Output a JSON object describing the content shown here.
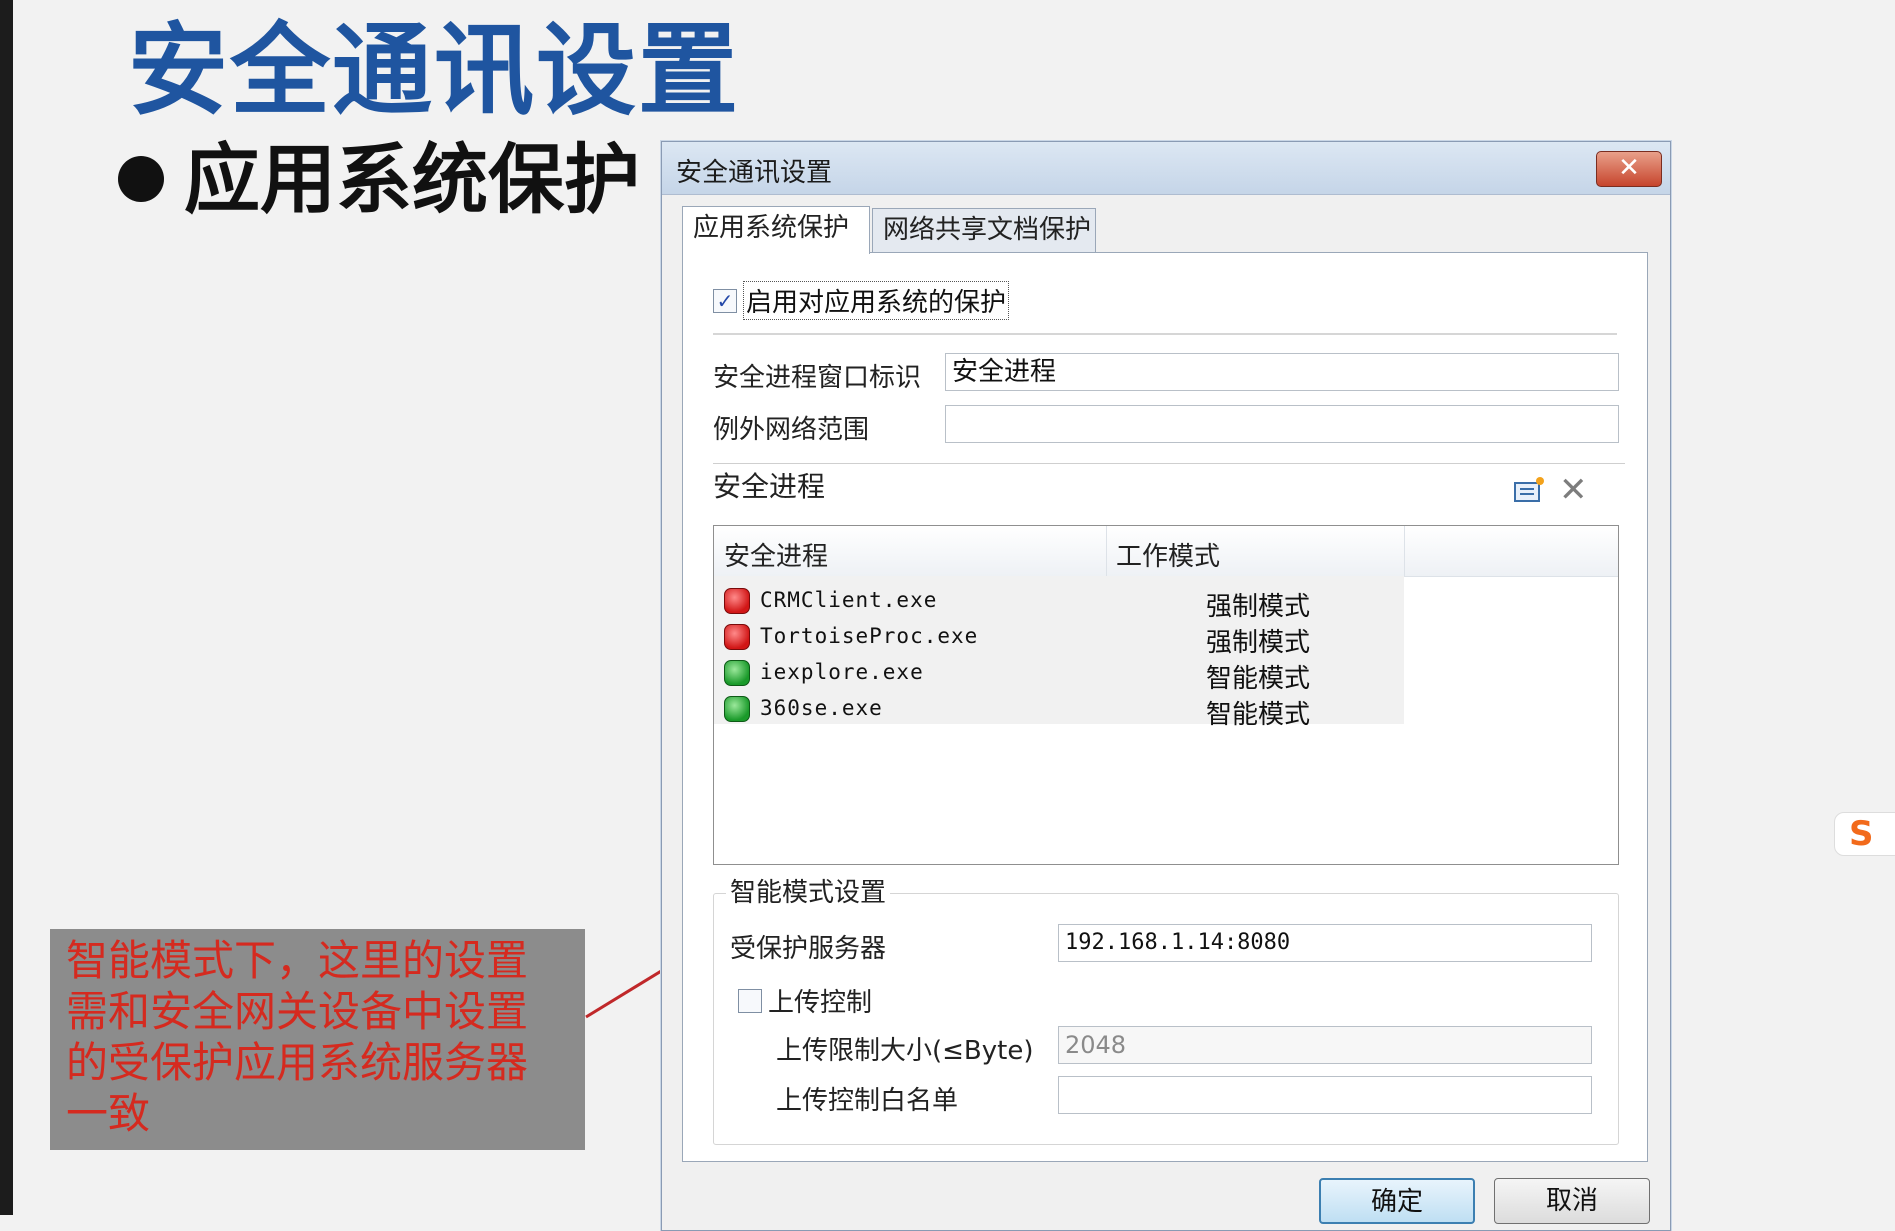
{
  "slide": {
    "title": "安全通讯设置",
    "bullet": "应用系统保护",
    "callout": "智能模式下，这里的设置需和安全网关设备中设置的受保护应用系统服务器一致"
  },
  "dialog": {
    "title": "安全通讯设置",
    "close_label": "✕",
    "tabs": [
      {
        "label": "应用系统保护",
        "active": true
      },
      {
        "label": "网络共享文档保护",
        "active": false
      }
    ],
    "enable_checkbox": {
      "label": "启用对应用系统的保护",
      "checked": true,
      "mark": "✓"
    },
    "fields": {
      "window_id_label": "安全进程窗口标识",
      "window_id_value": "安全进程",
      "exception_label": "例外网络范围",
      "exception_value": ""
    },
    "process_section": {
      "title": "安全进程",
      "delete_glyph": "✕",
      "columns": [
        "安全进程",
        "工作模式"
      ],
      "rows": [
        {
          "name": "CRMClient.exe",
          "mode": "强制模式",
          "status": "red"
        },
        {
          "name": "TortoiseProc.exe",
          "mode": "强制模式",
          "status": "red"
        },
        {
          "name": "iexplore.exe",
          "mode": "智能模式",
          "status": "green"
        },
        {
          "name": "360se.exe",
          "mode": "智能模式",
          "status": "green"
        }
      ]
    },
    "smart_mode": {
      "title": "智能模式设置",
      "server_label": "受保护服务器",
      "server_value": "192.168.1.14:8080",
      "upload_checkbox": {
        "label": "上传控制",
        "checked": false
      },
      "size_limit_label": "上传限制大小(≤Byte)",
      "size_limit_value": "2048",
      "whitelist_label": "上传控制白名单",
      "whitelist_value": ""
    },
    "buttons": {
      "ok": "确定",
      "cancel": "取消"
    }
  },
  "widget": {
    "label": "S"
  },
  "colors": {
    "title_blue": "#1f55a0",
    "callout_bg": "#8c8c8c",
    "callout_text": "#d52a1f",
    "arrow": "#c0282a"
  }
}
